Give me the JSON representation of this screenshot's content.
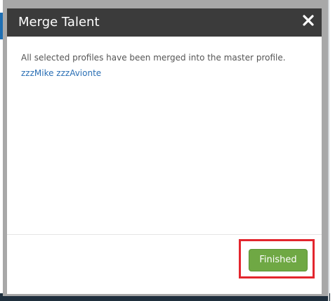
{
  "modal": {
    "title": "Merge Talent",
    "message": "All selected profiles have been merged into the master profile.",
    "profile_link": "zzzMike zzzAvionte",
    "finished_label": "Finished",
    "close_icon": "close-icon"
  },
  "colors": {
    "header_bg": "#3b3b3b",
    "button_bg": "#6fa844",
    "link": "#2a6fb5",
    "highlight": "#e3262e"
  }
}
